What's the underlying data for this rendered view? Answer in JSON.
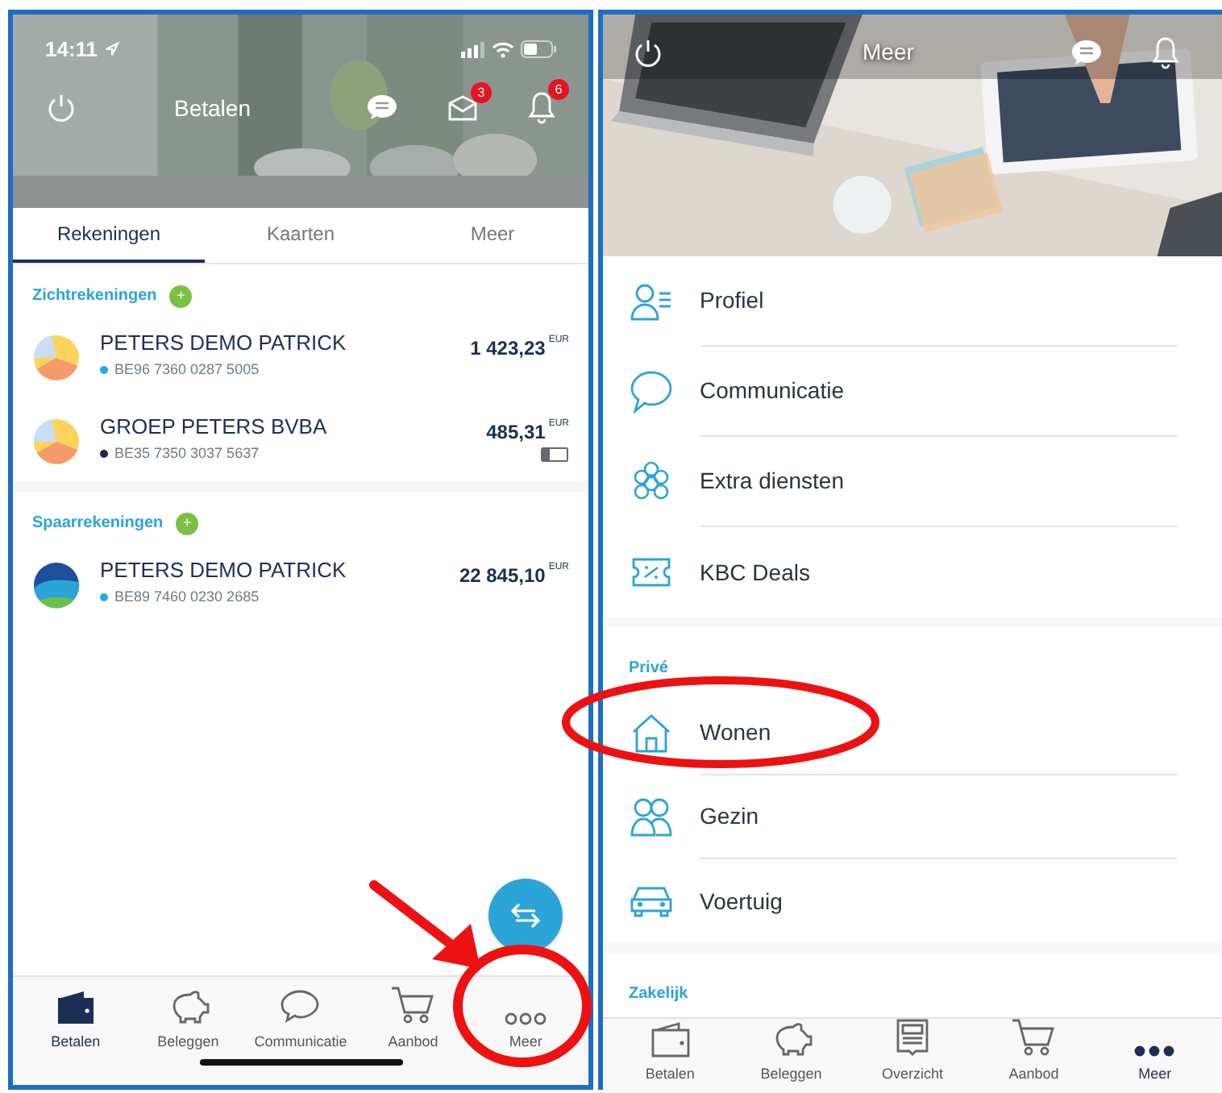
{
  "left_screen": {
    "status_bar": {
      "time": "14:11"
    },
    "header": {
      "title": "Betalen",
      "mail_badge": "3",
      "bell_badge": "6"
    },
    "tabs": [
      {
        "label": "Rekeningen",
        "selected": true
      },
      {
        "label": "Kaarten",
        "selected": false
      },
      {
        "label": "Meer",
        "selected": false
      }
    ],
    "sections": [
      {
        "title": "Zichtrekeningen",
        "add": "+",
        "accounts": [
          {
            "kind": "chart",
            "name": "PETERS DEMO PATRICK",
            "iban": "BE96 7360 0287 5005",
            "color": "#29a8e0",
            "amount": "1 423,23",
            "currency": "EUR",
            "card": false
          },
          {
            "kind": "chart",
            "name": "GROEP PETERS BVBA",
            "iban": "BE35 7350 3037 5637",
            "color": "#1a2b4a",
            "amount": "485,31",
            "currency": "EUR",
            "card": true
          }
        ]
      },
      {
        "title": "Spaarrekeningen",
        "add": "+",
        "accounts": [
          {
            "kind": "savings",
            "name": "PETERS DEMO PATRICK",
            "iban": "BE89 7460 0230 2685",
            "color": "#29a8e0",
            "amount": "22 845,10",
            "currency": "EUR",
            "card": false
          }
        ]
      }
    ],
    "bottom_nav": [
      {
        "label": "Betalen",
        "selected": true
      },
      {
        "label": "Beleggen",
        "selected": false
      },
      {
        "label": "Communicatie",
        "selected": false
      },
      {
        "label": "Aanbod",
        "selected": false
      },
      {
        "label": "Meer",
        "selected": false
      }
    ]
  },
  "right_screen": {
    "header": {
      "title": "Meer"
    },
    "groups": [
      {
        "items": [
          "Profiel",
          "Communicatie",
          "Extra diensten",
          "KBC Deals"
        ]
      },
      {
        "title": "Privé",
        "items": [
          "Wonen",
          "Gezin",
          "Voertuig"
        ]
      },
      {
        "title": "Zakelijk"
      }
    ],
    "bottom_nav": [
      {
        "label": "Betalen",
        "selected": false
      },
      {
        "label": "Beleggen",
        "selected": false
      },
      {
        "label": "Overzicht",
        "selected": false
      },
      {
        "label": "Aanbod",
        "selected": false
      },
      {
        "label": "Meer",
        "selected": true
      }
    ]
  }
}
